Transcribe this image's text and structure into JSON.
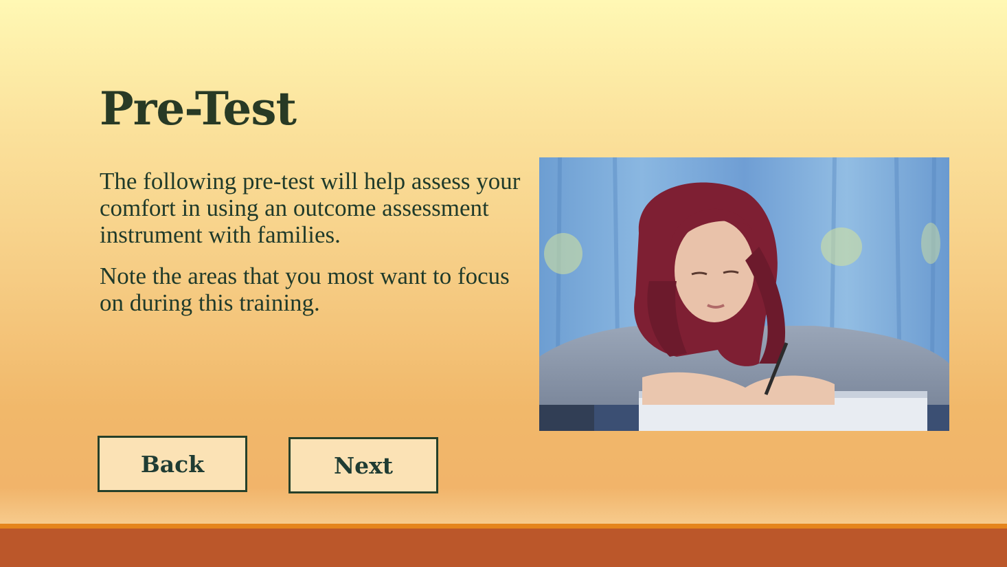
{
  "slide": {
    "title": "Pre-Test",
    "paragraphs": [
      "The following pre-test will help assess your comfort in using an outcome assessment instrument with families.",
      "Note the areas that you most want to focus on during this training."
    ]
  },
  "navigation": {
    "back_label": "Back",
    "next_label": "Next"
  },
  "colors": {
    "title": "#283a25",
    "button_border": "#25402a",
    "button_fill": "#fbe2b5",
    "footer_bar": "#bb572a",
    "footer_stripe": "#e5851d"
  }
}
